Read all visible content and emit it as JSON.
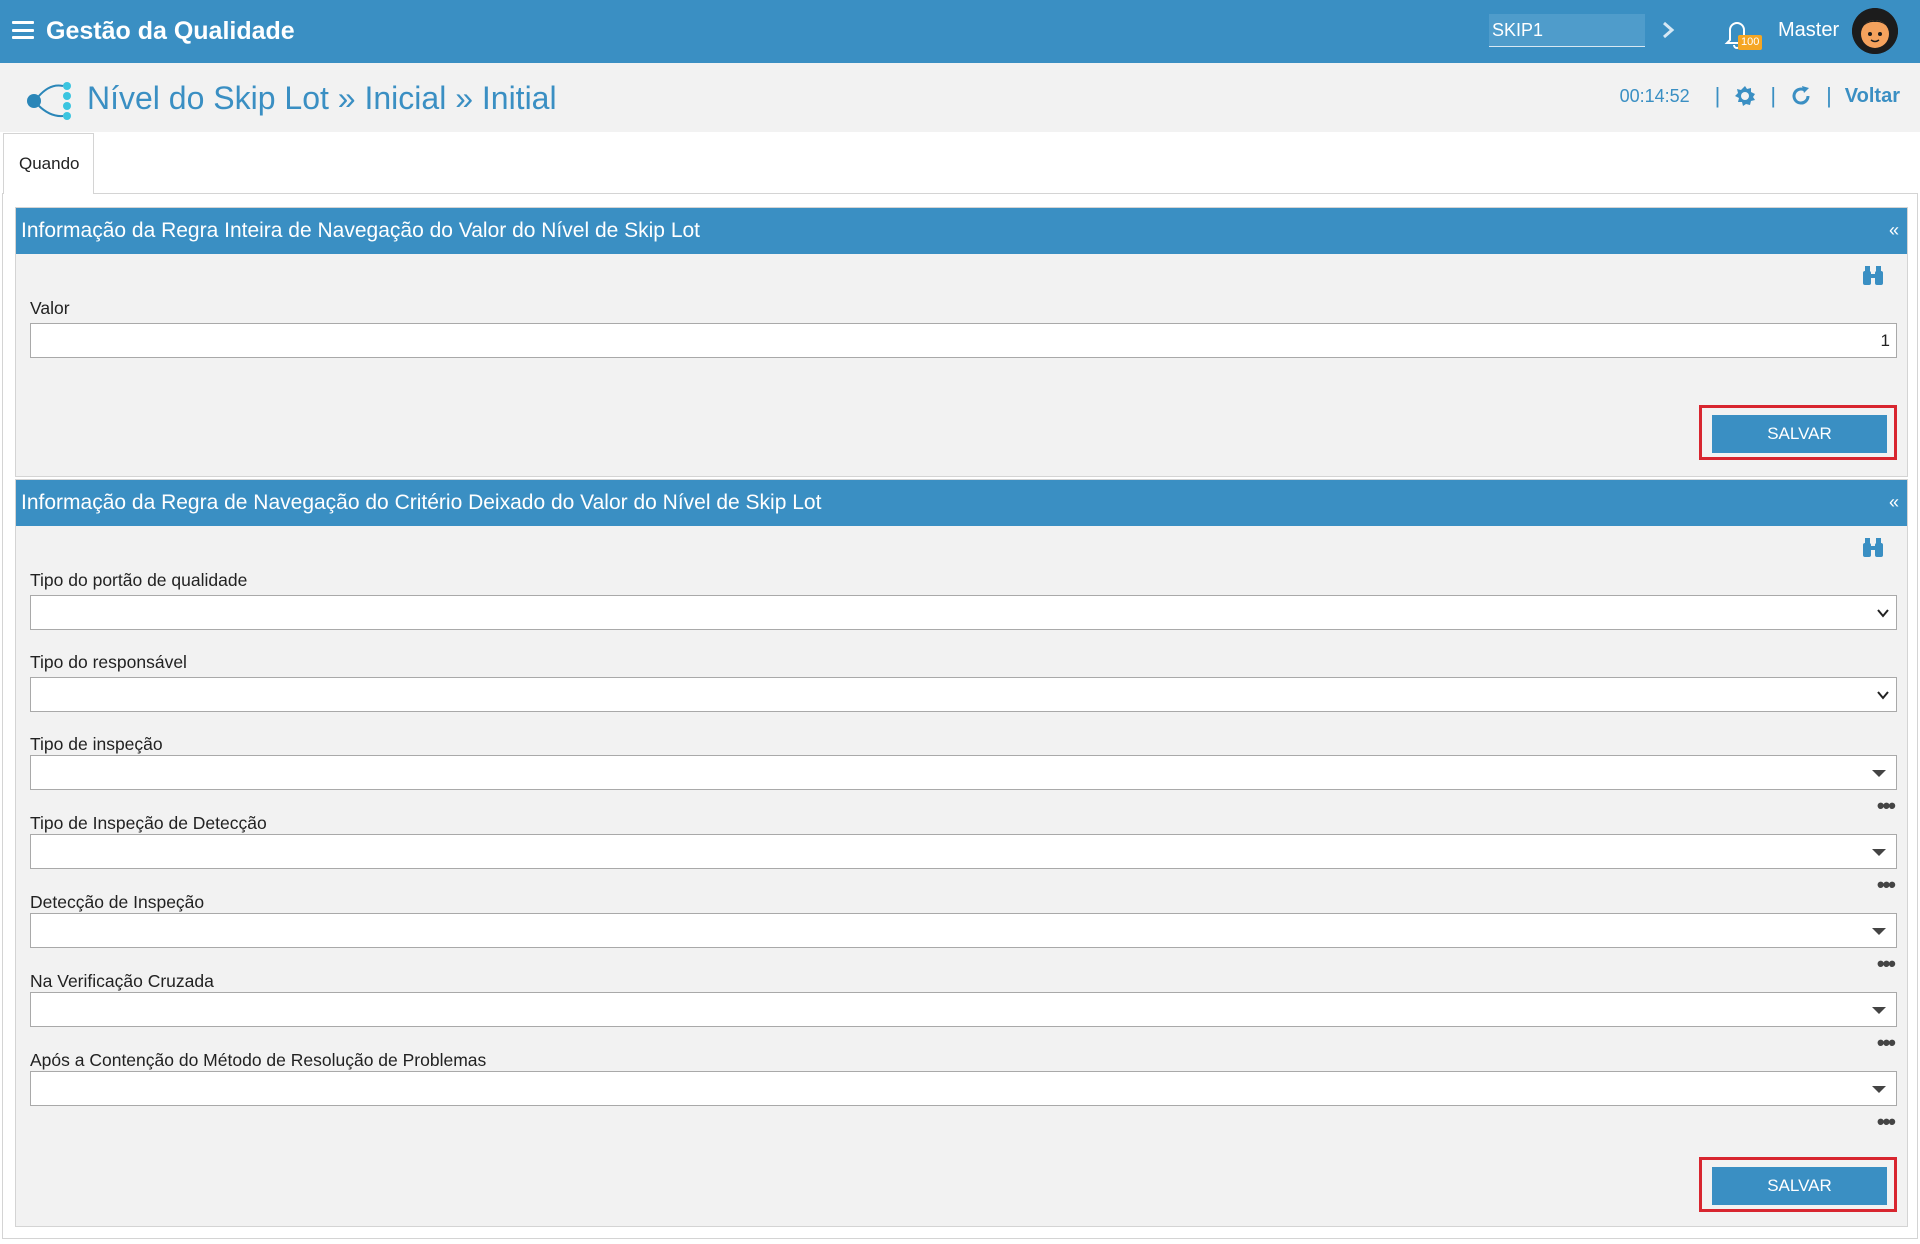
{
  "topbar": {
    "app_title": "Gestão da Qualidade",
    "search_value": "SKIP1",
    "notification_count": "100",
    "user_name": "Master"
  },
  "header": {
    "title": "Nível do Skip Lot » Inicial » Initial",
    "timer": "00:14:52",
    "back_label": "Voltar"
  },
  "tabs": [
    {
      "label": "Quando"
    }
  ],
  "section1": {
    "title": "Informação da Regra Inteira de Navegação do Valor do Nível de Skip Lot",
    "collapse": "«",
    "value_label": "Valor",
    "value": "1",
    "save_label": "SALVAR"
  },
  "section2": {
    "title": "Informação da Regra de Navegação do Critério Deixado do Valor do Nível de Skip Lot",
    "collapse": "«",
    "fields": [
      {
        "label": "Tipo do portão de qualidade"
      },
      {
        "label": "Tipo do responsável"
      },
      {
        "label": "Tipo de inspeção"
      },
      {
        "label": "Tipo de Inspeção de Detecção"
      },
      {
        "label": "Detecção de Inspeção"
      },
      {
        "label": "Na Verificação Cruzada"
      },
      {
        "label": "Após a Contenção do Método de Resolução de Problemas"
      }
    ],
    "save_label": "SALVAR"
  }
}
